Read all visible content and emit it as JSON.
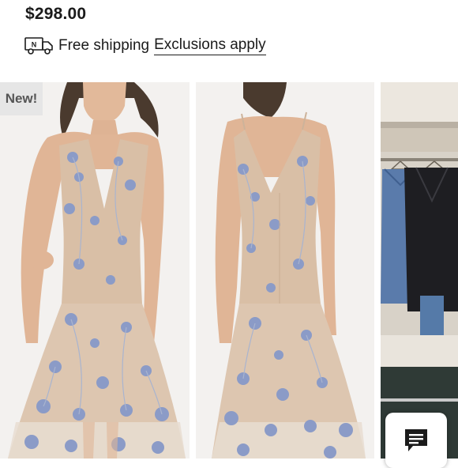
{
  "product": {
    "price": "$298.00"
  },
  "shipping": {
    "truck_badge": "N",
    "text": "Free shipping",
    "exclusions_link": "Exclusions apply"
  },
  "gallery": {
    "badge": "New!",
    "images": [
      "dress-front-photo",
      "dress-back-photo",
      "jacket-rack-photo"
    ]
  },
  "chat": {
    "icon": "chat-bubble-icon"
  },
  "colors": {
    "text": "#1b1b1b",
    "badge_bg": "#e6e6e6",
    "badge_text": "#555555",
    "dress_base": "#d9bfa6",
    "flower_blue": "#8b9bc7"
  }
}
